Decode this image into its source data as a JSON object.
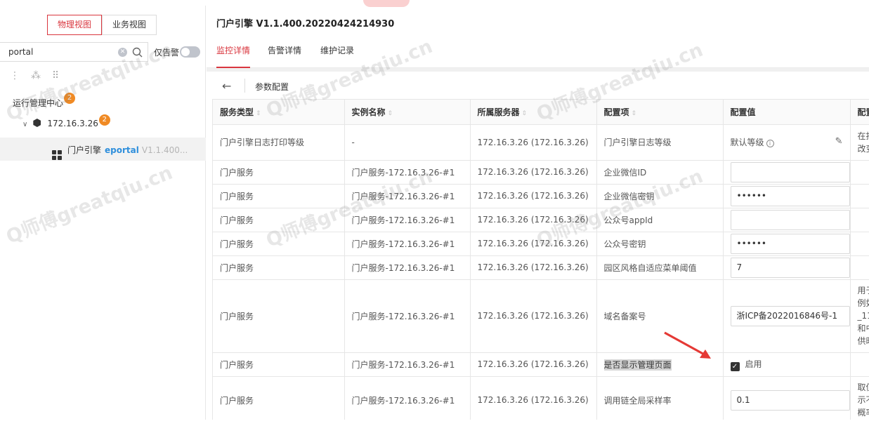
{
  "left": {
    "view_tabs": [
      "物理视图",
      "业务视图"
    ],
    "search_value": "portal",
    "alarm_only_label": "仅告警",
    "tree": {
      "root_label": "运行管理中心",
      "root_badge": "2",
      "server_label": "172.16.3.26",
      "server_badge": "2",
      "app_label": "门户引擎",
      "app_name": "eportal",
      "app_version": "V1.1.400..."
    }
  },
  "right": {
    "title": "门户引擎 V1.1.400.20220424214930",
    "tabs": [
      "监控详情",
      "告警详情",
      "维护记录"
    ],
    "sub_title": "参数配置",
    "columns": [
      "服务类型",
      "实例名称",
      "所属服务器",
      "配置项",
      "配置值",
      "配置"
    ],
    "rows": [
      {
        "type": "门户引擎日志打印等级",
        "instance": "-",
        "server": "172.16.3.26 (172.16.3.26)",
        "item": "门户引擎日志等级",
        "value": "默认等级",
        "desc": "在排\n改变"
      },
      {
        "type": "门户服务",
        "instance": "门户服务-172.16.3.26-#1",
        "server": "172.16.3.26 (172.16.3.26)",
        "item": "企业微信ID",
        "value": "",
        "desc": ""
      },
      {
        "type": "门户服务",
        "instance": "门户服务-172.16.3.26-#1",
        "server": "172.16.3.26 (172.16.3.26)",
        "item": "企业微信密钥",
        "value": "••••••",
        "desc": ""
      },
      {
        "type": "门户服务",
        "instance": "门户服务-172.16.3.26-#1",
        "server": "172.16.3.26 (172.16.3.26)",
        "item": "公众号appId",
        "value": "",
        "desc": ""
      },
      {
        "type": "门户服务",
        "instance": "门户服务-172.16.3.26-#1",
        "server": "172.16.3.26 (172.16.3.26)",
        "item": "公众号密钥",
        "value": "••••••",
        "desc": ""
      },
      {
        "type": "门户服务",
        "instance": "门户服务-172.16.3.26-#1",
        "server": "172.16.3.26 (172.16.3.26)",
        "item": "园区风格自适应菜单阈值",
        "value": "7",
        "desc": ""
      },
      {
        "type": "门户服务",
        "instance": "门户服务-172.16.3.26-#1",
        "server": "172.16.3.26 (172.16.3.26)",
        "item": "域名备案号",
        "value": "浙ICP备2022016846号-1",
        "desc": "用于\n例如\n_11\n和中\n供时"
      },
      {
        "type": "门户服务",
        "instance": "门户服务-172.16.3.26-#1",
        "server": "172.16.3.26 (172.16.3.26)",
        "item": "是否显示管理页面",
        "value": "启用",
        "desc": ""
      },
      {
        "type": "门户服务",
        "instance": "门户服务-172.16.3.26-#1",
        "server": "172.16.3.26 (172.16.3.26)",
        "item": "调用链全局采样率",
        "value": "0.1",
        "desc": "取值\n示不\n概率"
      }
    ]
  },
  "watermark_text": "Q师傅greatqiu.cn",
  "colors": {
    "accent": "#d9363e",
    "badge": "#f08a24",
    "link": "#2f8fdc",
    "arrow": "#e53935"
  }
}
